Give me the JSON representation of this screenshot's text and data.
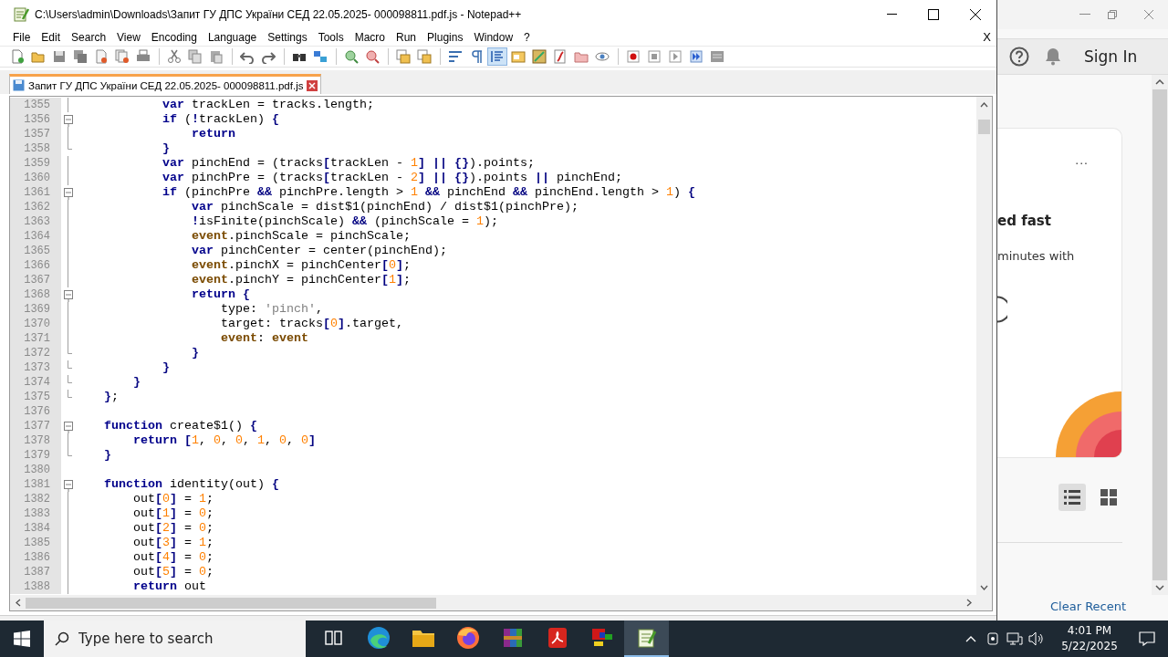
{
  "window": {
    "title": "C:\\Users\\admin\\Downloads\\Запит ГУ ДПС України СЕД 22.05.2025- 000098811.pdf.js - Notepad++"
  },
  "menu": [
    "File",
    "Edit",
    "Search",
    "View",
    "Encoding",
    "Language",
    "Settings",
    "Tools",
    "Macro",
    "Run",
    "Plugins",
    "Window",
    "?"
  ],
  "menu_close": "X",
  "tab": {
    "label": "Запит ГУ ДПС України СЕД 22.05.2025- 000098811.pdf.js",
    "selected": true
  },
  "editor": {
    "lines": [
      {
        "number": "1355",
        "kind": "body",
        "code": [
          {
            "kind": "keyword",
            "text": "            var"
          },
          {
            "kind": "plain",
            "text": " trackLen = tracks.length;"
          }
        ]
      },
      {
        "number": "1356",
        "kind": "open",
        "code": [
          {
            "kind": "keyword",
            "text": "            if"
          },
          {
            "kind": "plain",
            "text": " ("
          },
          {
            "kind": "operator",
            "text": "!"
          },
          {
            "kind": "plain",
            "text": "trackLen) "
          },
          {
            "kind": "operator",
            "text": "{"
          }
        ]
      },
      {
        "number": "1357",
        "kind": "body",
        "code": [
          {
            "kind": "keyword",
            "text": "                return"
          }
        ]
      },
      {
        "number": "1358",
        "kind": "end",
        "code": [
          {
            "kind": "operator",
            "text": "            }"
          }
        ]
      },
      {
        "number": "1359",
        "kind": "body",
        "code": [
          {
            "kind": "keyword",
            "text": "            var"
          },
          {
            "kind": "plain",
            "text": " pinchEnd = (tracks"
          },
          {
            "kind": "operator",
            "text": "["
          },
          {
            "kind": "plain",
            "text": "trackLen - "
          },
          {
            "kind": "number",
            "text": "1"
          },
          {
            "kind": "operator",
            "text": "] || {}"
          },
          {
            "kind": "plain",
            "text": ").points;"
          }
        ]
      },
      {
        "number": "1360",
        "kind": "body",
        "code": [
          {
            "kind": "keyword",
            "text": "            var"
          },
          {
            "kind": "plain",
            "text": " pinchPre = (tracks"
          },
          {
            "kind": "operator",
            "text": "["
          },
          {
            "kind": "plain",
            "text": "trackLen - "
          },
          {
            "kind": "number",
            "text": "2"
          },
          {
            "kind": "operator",
            "text": "] || {}"
          },
          {
            "kind": "plain",
            "text": ").points "
          },
          {
            "kind": "operator",
            "text": "||"
          },
          {
            "kind": "plain",
            "text": " pinchEnd;"
          }
        ]
      },
      {
        "number": "1361",
        "kind": "open",
        "code": [
          {
            "kind": "keyword",
            "text": "            if"
          },
          {
            "kind": "plain",
            "text": " (pinchPre "
          },
          {
            "kind": "operator",
            "text": "&&"
          },
          {
            "kind": "plain",
            "text": " pinchPre.length > "
          },
          {
            "kind": "number",
            "text": "1"
          },
          {
            "kind": "operator",
            "text": " &&"
          },
          {
            "kind": "plain",
            "text": " pinchEnd "
          },
          {
            "kind": "operator",
            "text": "&&"
          },
          {
            "kind": "plain",
            "text": " pinchEnd.length > "
          },
          {
            "kind": "number",
            "text": "1"
          },
          {
            "kind": "plain",
            "text": ") "
          },
          {
            "kind": "operator",
            "text": "{"
          }
        ]
      },
      {
        "number": "1362",
        "kind": "body",
        "code": [
          {
            "kind": "keyword",
            "text": "                var"
          },
          {
            "kind": "plain",
            "text": " pinchScale = dist$1(pinchEnd) / dist$1(pinchPre);"
          }
        ]
      },
      {
        "number": "1363",
        "kind": "body",
        "code": [
          {
            "kind": "operator",
            "text": "                !"
          },
          {
            "kind": "plain",
            "text": "isFinite(pinchScale) "
          },
          {
            "kind": "operator",
            "text": "&&"
          },
          {
            "kind": "plain",
            "text": " (pinchScale = "
          },
          {
            "kind": "number",
            "text": "1"
          },
          {
            "kind": "plain",
            "text": ");"
          }
        ]
      },
      {
        "number": "1364",
        "kind": "body",
        "code": [
          {
            "kind": "word",
            "text": "                event"
          },
          {
            "kind": "plain",
            "text": ".pinchScale = pinchScale;"
          }
        ]
      },
      {
        "number": "1365",
        "kind": "body",
        "code": [
          {
            "kind": "keyword",
            "text": "                var"
          },
          {
            "kind": "plain",
            "text": " pinchCenter = center(pinchEnd);"
          }
        ]
      },
      {
        "number": "1366",
        "kind": "body",
        "code": [
          {
            "kind": "word",
            "text": "                event"
          },
          {
            "kind": "plain",
            "text": ".pinchX = pinchCenter"
          },
          {
            "kind": "operator",
            "text": "["
          },
          {
            "kind": "number",
            "text": "0"
          },
          {
            "kind": "operator",
            "text": "]"
          },
          {
            "kind": "plain",
            "text": ";"
          }
        ]
      },
      {
        "number": "1367",
        "kind": "body",
        "code": [
          {
            "kind": "word",
            "text": "                event"
          },
          {
            "kind": "plain",
            "text": ".pinchY = pinchCenter"
          },
          {
            "kind": "operator",
            "text": "["
          },
          {
            "kind": "number",
            "text": "1"
          },
          {
            "kind": "operator",
            "text": "]"
          },
          {
            "kind": "plain",
            "text": ";"
          }
        ]
      },
      {
        "number": "1368",
        "kind": "open",
        "code": [
          {
            "kind": "keyword",
            "text": "                return"
          },
          {
            "kind": "operator",
            "text": " {"
          }
        ]
      },
      {
        "number": "1369",
        "kind": "body",
        "code": [
          {
            "kind": "plain",
            "text": "                    type: "
          },
          {
            "kind": "string",
            "text": "'pinch'"
          },
          {
            "kind": "plain",
            "text": ","
          }
        ]
      },
      {
        "number": "1370",
        "kind": "body",
        "code": [
          {
            "kind": "plain",
            "text": "                    target: tracks"
          },
          {
            "kind": "operator",
            "text": "["
          },
          {
            "kind": "number",
            "text": "0"
          },
          {
            "kind": "operator",
            "text": "]"
          },
          {
            "kind": "plain",
            "text": ".target,"
          }
        ]
      },
      {
        "number": "1371",
        "kind": "body",
        "code": [
          {
            "kind": "word",
            "text": "                    event"
          },
          {
            "kind": "plain",
            "text": ": "
          },
          {
            "kind": "word",
            "text": "event"
          }
        ]
      },
      {
        "number": "1372",
        "kind": "end",
        "code": [
          {
            "kind": "operator",
            "text": "                }"
          }
        ]
      },
      {
        "number": "1373",
        "kind": "end",
        "code": [
          {
            "kind": "operator",
            "text": "            }"
          }
        ]
      },
      {
        "number": "1374",
        "kind": "end",
        "code": [
          {
            "kind": "operator",
            "text": "        }"
          }
        ]
      },
      {
        "number": "1375",
        "kind": "end",
        "code": [
          {
            "kind": "operator",
            "text": "    }"
          },
          {
            "kind": "plain",
            "text": ";"
          }
        ]
      },
      {
        "number": "1376",
        "kind": "blank"
      },
      {
        "number": "1377",
        "kind": "open",
        "code": [
          {
            "kind": "keyword",
            "text": "    function"
          },
          {
            "kind": "plain",
            "text": " create$1() "
          },
          {
            "kind": "operator",
            "text": "{"
          }
        ]
      },
      {
        "number": "1378",
        "kind": "body",
        "code": [
          {
            "kind": "keyword",
            "text": "        return"
          },
          {
            "kind": "operator",
            "text": " ["
          },
          {
            "kind": "number",
            "text": "1"
          },
          {
            "kind": "plain",
            "text": ", "
          },
          {
            "kind": "number",
            "text": "0"
          },
          {
            "kind": "plain",
            "text": ", "
          },
          {
            "kind": "number",
            "text": "0"
          },
          {
            "kind": "plain",
            "text": ", "
          },
          {
            "kind": "number",
            "text": "1"
          },
          {
            "kind": "plain",
            "text": ", "
          },
          {
            "kind": "number",
            "text": "0"
          },
          {
            "kind": "plain",
            "text": ", "
          },
          {
            "kind": "number",
            "text": "0"
          },
          {
            "kind": "operator",
            "text": "]"
          }
        ]
      },
      {
        "number": "1379",
        "kind": "end",
        "code": [
          {
            "kind": "operator",
            "text": "    }"
          }
        ]
      },
      {
        "number": "1380",
        "kind": "blank"
      },
      {
        "number": "1381",
        "kind": "open",
        "code": [
          {
            "kind": "keyword",
            "text": "    function"
          },
          {
            "kind": "plain",
            "text": " identity(out) "
          },
          {
            "kind": "operator",
            "text": "{"
          }
        ]
      },
      {
        "number": "1382",
        "kind": "body",
        "code": [
          {
            "kind": "plain",
            "text": "        out"
          },
          {
            "kind": "operator",
            "text": "["
          },
          {
            "kind": "number",
            "text": "0"
          },
          {
            "kind": "operator",
            "text": "]"
          },
          {
            "kind": "plain",
            "text": " = "
          },
          {
            "kind": "number",
            "text": "1"
          },
          {
            "kind": "plain",
            "text": ";"
          }
        ]
      },
      {
        "number": "1383",
        "kind": "body",
        "code": [
          {
            "kind": "plain",
            "text": "        out"
          },
          {
            "kind": "operator",
            "text": "["
          },
          {
            "kind": "number",
            "text": "1"
          },
          {
            "kind": "operator",
            "text": "]"
          },
          {
            "kind": "plain",
            "text": " = "
          },
          {
            "kind": "number",
            "text": "0"
          },
          {
            "kind": "plain",
            "text": ";"
          }
        ]
      },
      {
        "number": "1384",
        "kind": "body",
        "code": [
          {
            "kind": "plain",
            "text": "        out"
          },
          {
            "kind": "operator",
            "text": "["
          },
          {
            "kind": "number",
            "text": "2"
          },
          {
            "kind": "operator",
            "text": "]"
          },
          {
            "kind": "plain",
            "text": " = "
          },
          {
            "kind": "number",
            "text": "0"
          },
          {
            "kind": "plain",
            "text": ";"
          }
        ]
      },
      {
        "number": "1385",
        "kind": "body",
        "code": [
          {
            "kind": "plain",
            "text": "        out"
          },
          {
            "kind": "operator",
            "text": "["
          },
          {
            "kind": "number",
            "text": "3"
          },
          {
            "kind": "operator",
            "text": "]"
          },
          {
            "kind": "plain",
            "text": " = "
          },
          {
            "kind": "number",
            "text": "1"
          },
          {
            "kind": "plain",
            "text": ";"
          }
        ]
      },
      {
        "number": "1386",
        "kind": "body",
        "code": [
          {
            "kind": "plain",
            "text": "        out"
          },
          {
            "kind": "operator",
            "text": "["
          },
          {
            "kind": "number",
            "text": "4"
          },
          {
            "kind": "operator",
            "text": "]"
          },
          {
            "kind": "plain",
            "text": " = "
          },
          {
            "kind": "number",
            "text": "0"
          },
          {
            "kind": "plain",
            "text": ";"
          }
        ]
      },
      {
        "number": "1387",
        "kind": "body",
        "code": [
          {
            "kind": "plain",
            "text": "        out"
          },
          {
            "kind": "operator",
            "text": "["
          },
          {
            "kind": "number",
            "text": "5"
          },
          {
            "kind": "operator",
            "text": "]"
          },
          {
            "kind": "plain",
            "text": " = "
          },
          {
            "kind": "number",
            "text": "0"
          },
          {
            "kind": "plain",
            "text": ";"
          }
        ]
      },
      {
        "number": "1388",
        "kind": "body",
        "code": [
          {
            "kind": "keyword",
            "text": "        return"
          },
          {
            "kind": "plain",
            "text": " out"
          }
        ]
      }
    ]
  },
  "background_app": {
    "sign_in": "Sign In",
    "card": {
      "more": "...",
      "title": "ed fast",
      "text": "minutes with"
    },
    "view_buttons": [
      {
        "kind": "list",
        "selected": true
      },
      {
        "kind": "grid",
        "selected": false
      }
    ],
    "clear_recent": "Clear Recent"
  },
  "taskbar": {
    "search": {
      "placeholder": "Type here to search"
    },
    "apps": [
      {
        "kind": "taskview",
        "selected": false
      },
      {
        "kind": "edge",
        "selected": false
      },
      {
        "kind": "explorer",
        "selected": false
      },
      {
        "kind": "firefox",
        "selected": false
      },
      {
        "kind": "archive",
        "selected": false
      },
      {
        "kind": "pdf",
        "selected": false
      },
      {
        "kind": "paint",
        "selected": false
      },
      {
        "kind": "notepad",
        "selected": true
      }
    ],
    "time": "4:01 PM",
    "date": "5/22/2025"
  }
}
